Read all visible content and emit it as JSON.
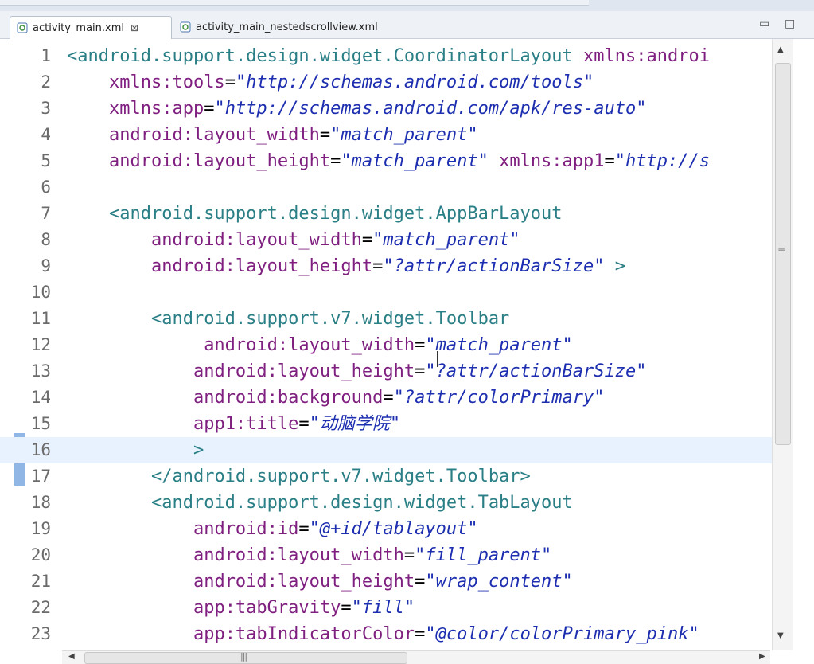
{
  "tabs": [
    {
      "label": "activity_main.xml",
      "active": true
    },
    {
      "label": "activity_main_nestedscrollview.xml",
      "active": false
    }
  ],
  "window_controls": {
    "minimize": "▭",
    "maximize": "□"
  },
  "editor": {
    "current_line": 16,
    "lines": [
      {
        "n": "1",
        "indent": "",
        "parts": [
          [
            "tag",
            "<android.support.design.widget.CoordinatorLayout "
          ],
          [
            "attr",
            "xmlns:androi"
          ]
        ]
      },
      {
        "n": "2",
        "indent": "    ",
        "parts": [
          [
            "attr",
            "xmlns:tools"
          ],
          [
            "eq",
            "="
          ],
          [
            "val",
            "\"http://schemas.android.com/tools\""
          ]
        ]
      },
      {
        "n": "3",
        "indent": "    ",
        "parts": [
          [
            "attr",
            "xmlns:app"
          ],
          [
            "eq",
            "="
          ],
          [
            "val",
            "\"http://schemas.android.com/apk/res-auto\""
          ]
        ]
      },
      {
        "n": "4",
        "indent": "    ",
        "parts": [
          [
            "attr",
            "android:layout_width"
          ],
          [
            "eq",
            "="
          ],
          [
            "val",
            "\"match_parent\""
          ]
        ]
      },
      {
        "n": "5",
        "indent": "    ",
        "parts": [
          [
            "attr",
            "android:layout_height"
          ],
          [
            "eq",
            "="
          ],
          [
            "val",
            "\"match_parent\""
          ],
          [
            "eq",
            " "
          ],
          [
            "attr",
            "xmlns:app1"
          ],
          [
            "eq",
            "="
          ],
          [
            "val",
            "\"http://s"
          ]
        ]
      },
      {
        "n": "6",
        "indent": "",
        "parts": []
      },
      {
        "n": "7",
        "indent": "    ",
        "parts": [
          [
            "tag",
            "<android.support.design.widget.AppBarLayout"
          ]
        ]
      },
      {
        "n": "8",
        "indent": "        ",
        "parts": [
          [
            "attr",
            "android:layout_width"
          ],
          [
            "eq",
            "="
          ],
          [
            "val",
            "\"match_parent\""
          ]
        ]
      },
      {
        "n": "9",
        "indent": "        ",
        "parts": [
          [
            "attr",
            "android:layout_height"
          ],
          [
            "eq",
            "="
          ],
          [
            "val",
            "\"?attr/actionBarSize\""
          ],
          [
            "eq",
            " "
          ],
          [
            "tag",
            ">"
          ]
        ]
      },
      {
        "n": "10",
        "indent": "",
        "parts": []
      },
      {
        "n": "11",
        "indent": "        ",
        "parts": [
          [
            "tag",
            "<android.support.v7.widget.Toolbar"
          ]
        ]
      },
      {
        "n": "12",
        "indent": "             ",
        "parts": [
          [
            "attr",
            "android:layout_width"
          ],
          [
            "eq",
            "="
          ],
          [
            "val",
            "\"match_parent\""
          ]
        ]
      },
      {
        "n": "13",
        "indent": "            ",
        "parts": [
          [
            "attr",
            "android:layout_height"
          ],
          [
            "eq",
            "="
          ],
          [
            "val",
            "\"?attr/actionBarSize\""
          ]
        ]
      },
      {
        "n": "14",
        "indent": "            ",
        "parts": [
          [
            "attr",
            "android:background"
          ],
          [
            "eq",
            "="
          ],
          [
            "val",
            "\"?attr/colorPrimary\""
          ]
        ]
      },
      {
        "n": "15",
        "indent": "            ",
        "parts": [
          [
            "attr",
            "app1:title"
          ],
          [
            "eq",
            "="
          ],
          [
            "val",
            "\"动脑学院\""
          ]
        ]
      },
      {
        "n": "16",
        "indent": "            ",
        "parts": [
          [
            "tag",
            ">"
          ]
        ]
      },
      {
        "n": "17",
        "indent": "        ",
        "parts": [
          [
            "tag",
            "</android.support.v7.widget.Toolbar>"
          ]
        ]
      },
      {
        "n": "18",
        "indent": "        ",
        "parts": [
          [
            "tag",
            "<android.support.design.widget.TabLayout"
          ]
        ]
      },
      {
        "n": "19",
        "indent": "            ",
        "parts": [
          [
            "attr",
            "android:id"
          ],
          [
            "eq",
            "="
          ],
          [
            "val",
            "\"@+id/tablayout\""
          ]
        ]
      },
      {
        "n": "20",
        "indent": "            ",
        "parts": [
          [
            "attr",
            "android:layout_width"
          ],
          [
            "eq",
            "="
          ],
          [
            "val",
            "\"fill_parent\""
          ]
        ]
      },
      {
        "n": "21",
        "indent": "            ",
        "parts": [
          [
            "attr",
            "android:layout_height"
          ],
          [
            "eq",
            "="
          ],
          [
            "val",
            "\"wrap_content\""
          ]
        ]
      },
      {
        "n": "22",
        "indent": "            ",
        "parts": [
          [
            "attr",
            "app:tabGravity"
          ],
          [
            "eq",
            "="
          ],
          [
            "val",
            "\"fill\""
          ]
        ]
      },
      {
        "n": "23",
        "indent": "            ",
        "parts": [
          [
            "attr",
            "app:tabIndicatorColor"
          ],
          [
            "eq",
            "="
          ],
          [
            "val",
            "\"@color/colorPrimary_pink\""
          ]
        ]
      }
    ]
  },
  "colors": {
    "tag": "#2a7f86",
    "attribute": "#7f1f7f",
    "value": "#1d2fb0",
    "current_line": "#e8f2fe",
    "change_marker": "#8fb6e4"
  },
  "scrollbar": {
    "vertical_grip": "≡",
    "horizontal_grip": "|||",
    "up": "▲",
    "down": "▼",
    "left": "◀",
    "right": "▶"
  }
}
